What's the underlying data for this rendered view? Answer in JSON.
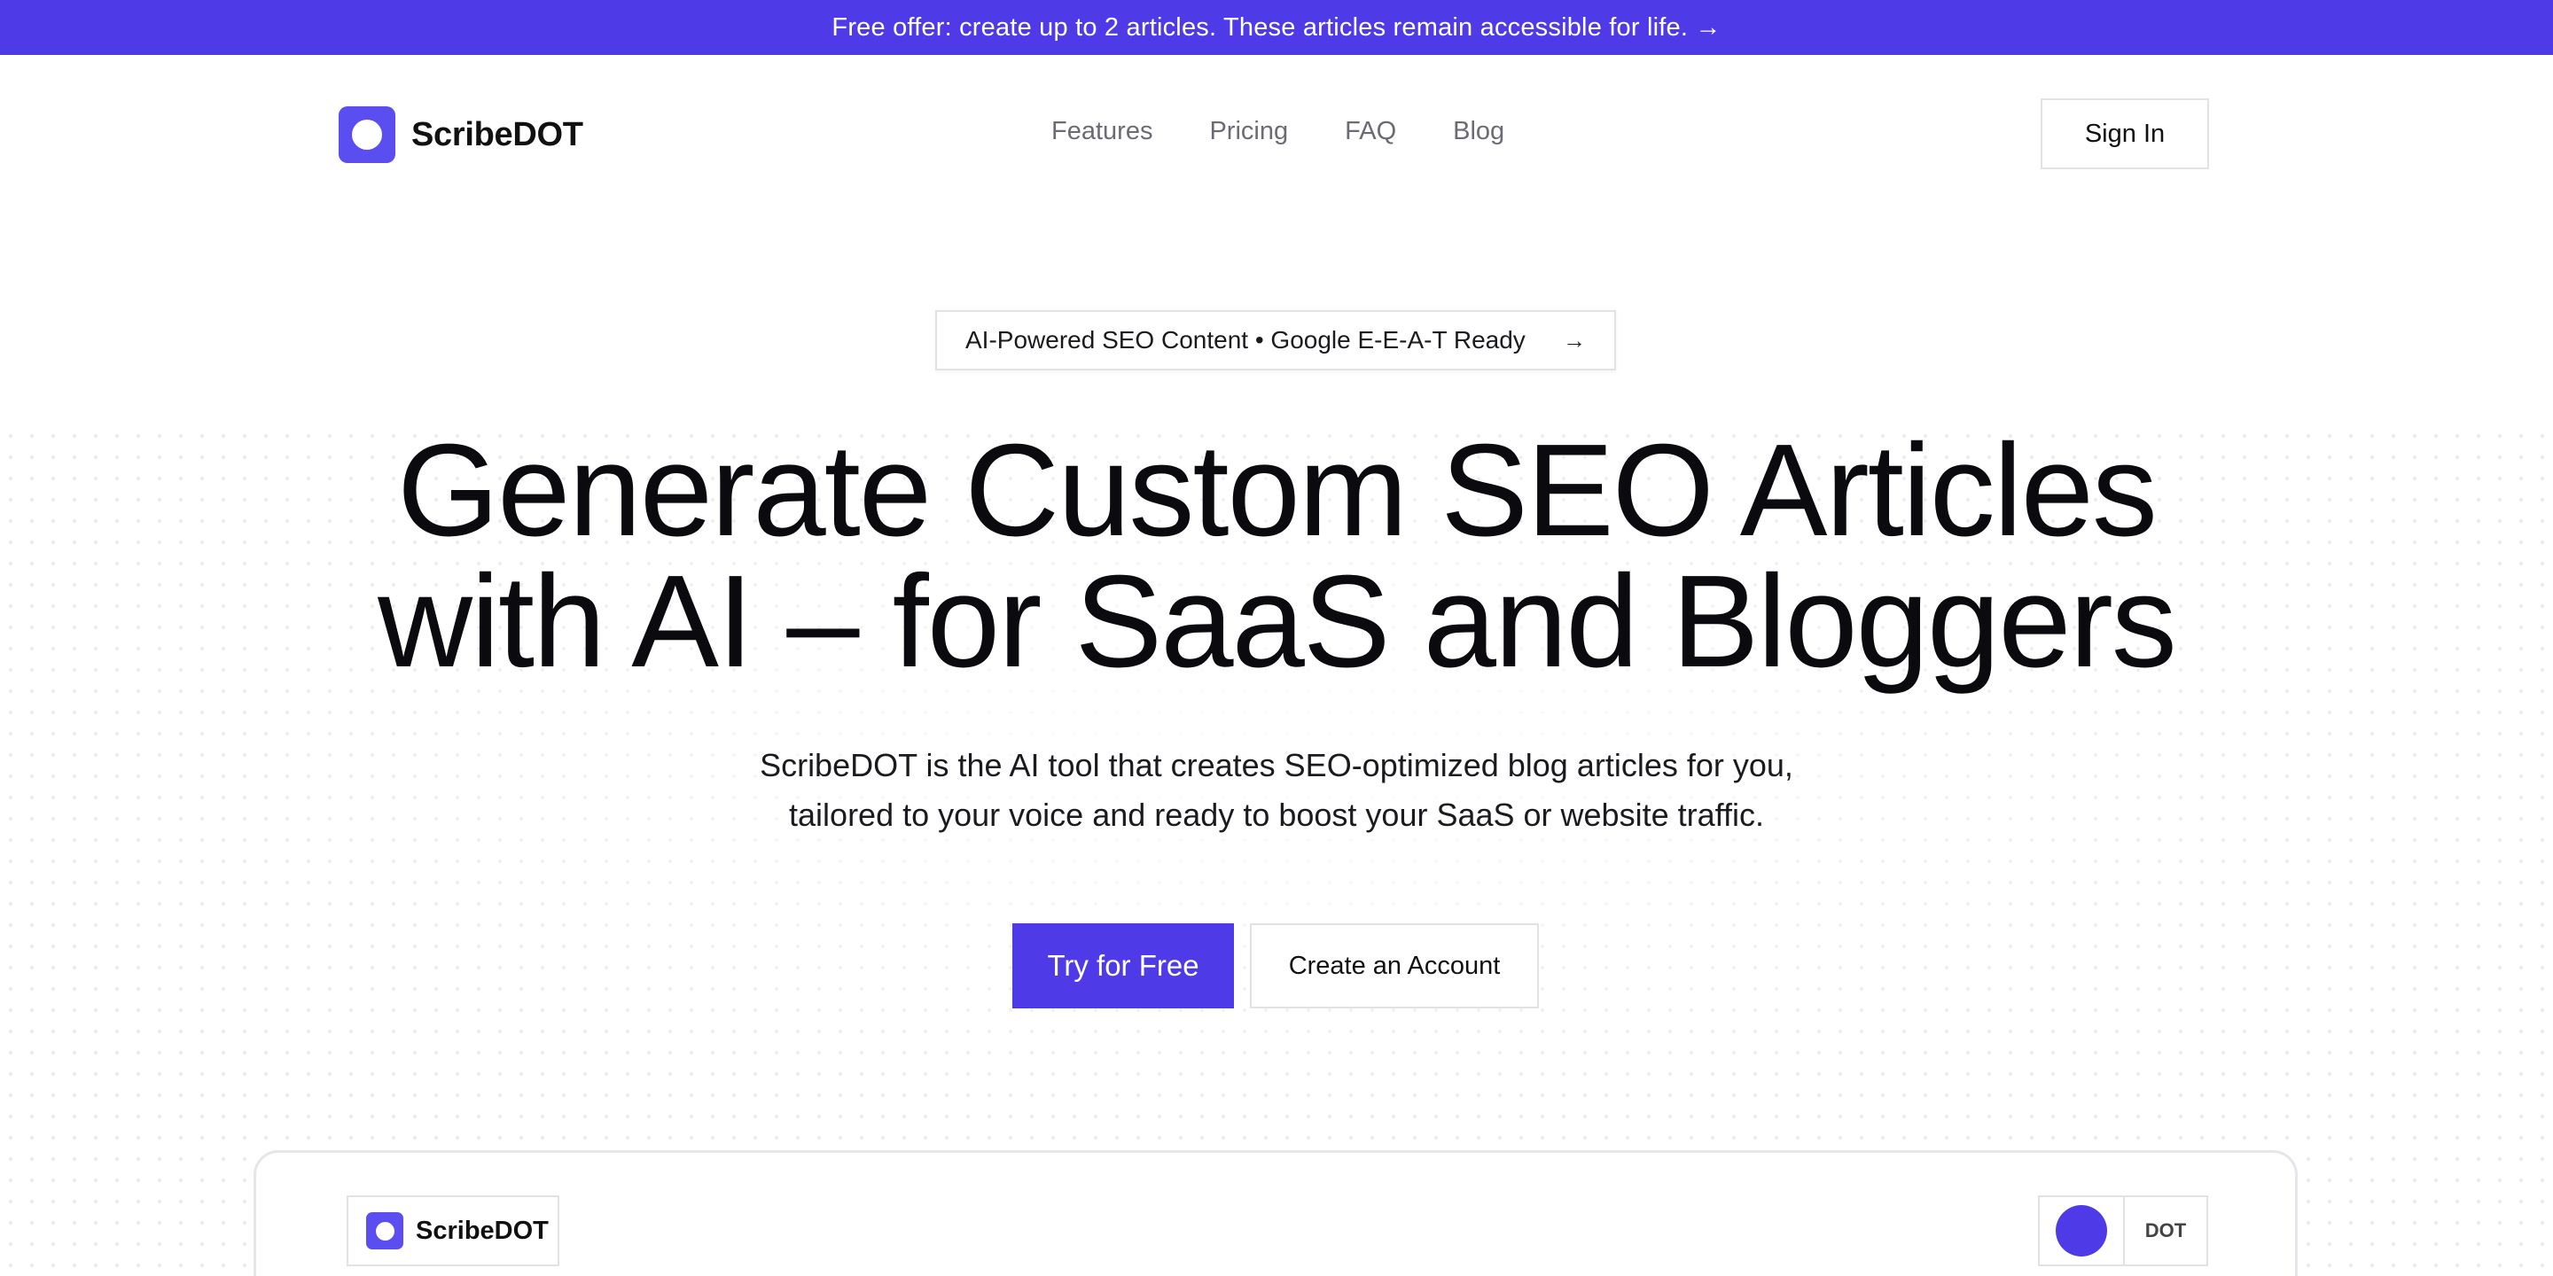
{
  "banner": {
    "text": "Free offer: create up to 2 articles. These articles remain accessible for life. →"
  },
  "header": {
    "brand": "ScribeDOT",
    "nav": [
      "Features",
      "Pricing",
      "FAQ",
      "Blog"
    ],
    "signin_label": "Sign In"
  },
  "hero": {
    "pill_text": "AI-Powered SEO Content • Google E-E-A-T Ready",
    "pill_arrow": "→",
    "title_lines": [
      "Generate Custom SEO Articles",
      "with AI – for SaaS and Bloggers"
    ],
    "subtitle_lines": [
      "ScribeDOT is the AI tool that creates SEO-optimized blog articles for you,",
      "tailored to your voice and ready to boost your SaaS or website traffic."
    ],
    "primary_cta": "Try for Free",
    "secondary_cta": "Create an Account"
  },
  "preview": {
    "brand": "ScribeDOT",
    "user_name": "DOT"
  },
  "colors": {
    "accent": "#4f3ae8",
    "logo": "#5b4ef0",
    "text": "#0b0b0f",
    "muted": "#6b6b73",
    "border": "#e2e2e6"
  },
  "icons": {
    "logo": "rounded-square-with-circle",
    "pill_arrow": "arrow-right-icon"
  }
}
